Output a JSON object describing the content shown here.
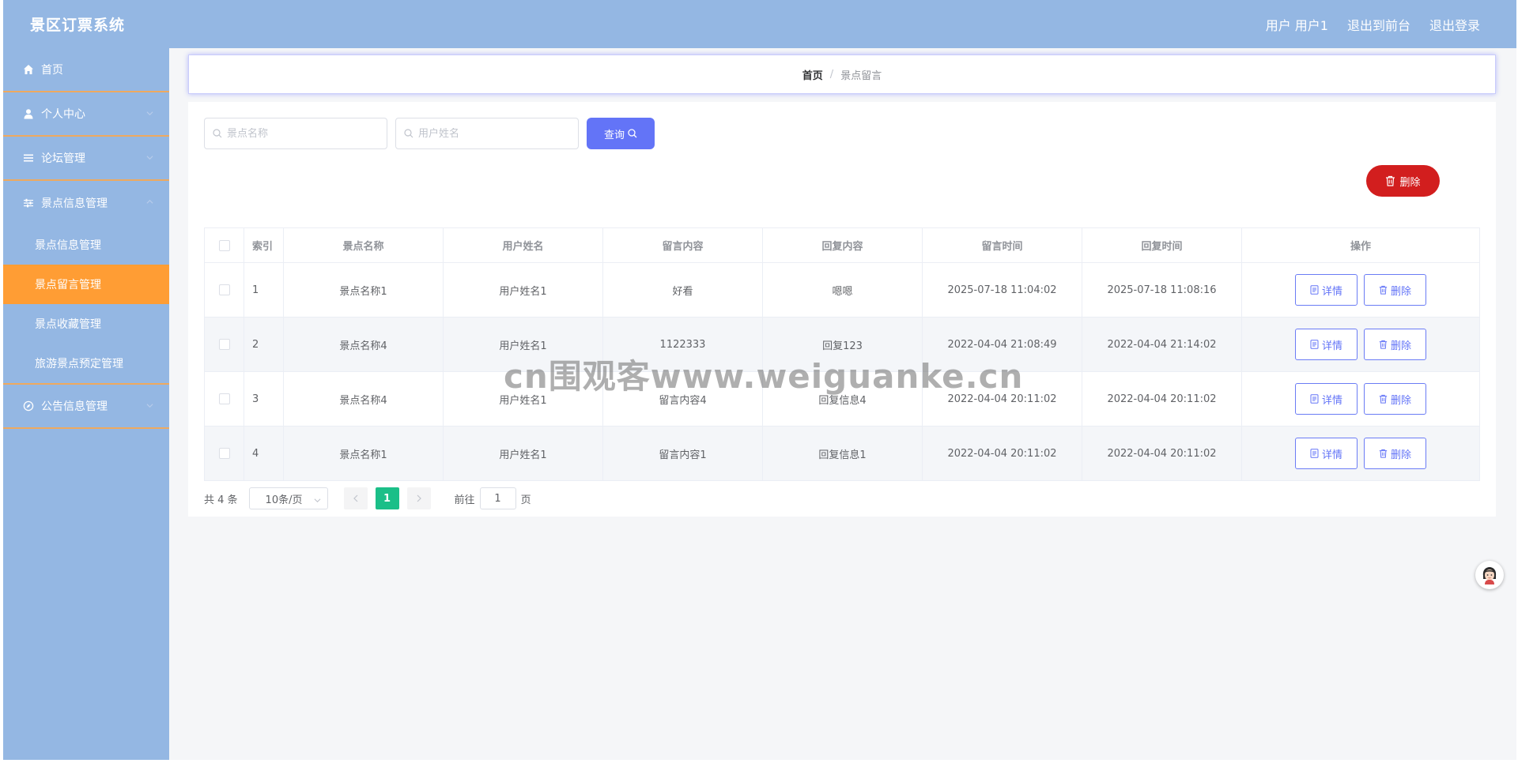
{
  "header": {
    "title": "景区订票系统",
    "user_label": "用户 用户1",
    "to_front": "退出到前台",
    "logout": "退出登录"
  },
  "sidebar": {
    "home": "首页",
    "personal_center": "个人中心",
    "forum_mgmt": "论坛管理",
    "scenic_info_mgmt": "景点信息管理",
    "sub_items": [
      "景点信息管理",
      "景点留言管理",
      "景点收藏管理",
      "旅游景点预定管理"
    ],
    "notice_mgmt": "公告信息管理",
    "active_item": "景点留言管理"
  },
  "breadcrumb": {
    "home": "首页",
    "separator": "/",
    "current": "景点留言"
  },
  "search": {
    "scenic_placeholder": "景点名称",
    "user_placeholder": "用户姓名",
    "query_button": "查询",
    "delete_button": "删除"
  },
  "table": {
    "headers": [
      "索引",
      "景点名称",
      "用户姓名",
      "留言内容",
      "回复内容",
      "留言时间",
      "回复时间",
      "操作"
    ],
    "rows": [
      {
        "index": "1",
        "scenic": "景点名称1",
        "user": "用户姓名1",
        "message": "好看",
        "reply": "嗯嗯",
        "msg_time": "2025-07-18 11:04:02",
        "reply_time": "2025-07-18 11:08:16"
      },
      {
        "index": "2",
        "scenic": "景点名称4",
        "user": "用户姓名1",
        "message": "1122333",
        "reply": "回复123",
        "msg_time": "2022-04-04 21:08:49",
        "reply_time": "2022-04-04 21:14:02"
      },
      {
        "index": "3",
        "scenic": "景点名称4",
        "user": "用户姓名1",
        "message": "留言内容4",
        "reply": "回复信息4",
        "msg_time": "2022-04-04 20:11:02",
        "reply_time": "2022-04-04 20:11:02"
      },
      {
        "index": "4",
        "scenic": "景点名称1",
        "user": "用户姓名1",
        "message": "留言内容1",
        "reply": "回复信息1",
        "msg_time": "2022-04-04 20:11:02",
        "reply_time": "2022-04-04 20:11:02"
      }
    ],
    "detail_label": "详情",
    "delete_label": "删除"
  },
  "pagination": {
    "total": "共 4 条",
    "page_size": "10条/页",
    "current_page": "1",
    "goto_prefix": "前往",
    "goto_value": "1",
    "goto_suffix": "页"
  },
  "watermark": "cn围观客www.weiguanke.cn",
  "colors": {
    "header_bg": "#94b7e3",
    "sidebar_active": "#ff9d34",
    "primary": "#6374f7",
    "danger": "#d21e1e",
    "page_active": "#1bbf88"
  }
}
